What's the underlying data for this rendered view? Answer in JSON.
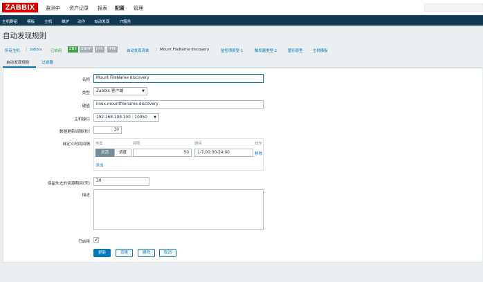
{
  "header": {
    "logo": "ZABBIX",
    "menu": [
      "监测中",
      "资产记录",
      "报表",
      "配置",
      "管理"
    ]
  },
  "subnav": [
    "主机群组",
    "模板",
    "主机",
    "维护",
    "动作",
    "自动发现",
    "IT服务"
  ],
  "page": {
    "title": "自动发现规则"
  },
  "breadcrumb": {
    "all_hosts": "所有主机",
    "sep": "/",
    "host": "zabbix",
    "enabled": "已启用",
    "badges": [
      {
        "label": "ZBX",
        "color": "#429e47"
      },
      {
        "label": "SNMP",
        "color": "#a1acb3"
      },
      {
        "label": "JMX",
        "color": "#a1acb3"
      },
      {
        "label": "IPMI",
        "color": "#a1acb3"
      }
    ],
    "discovery_list": "自动发现清单",
    "current": "Mount FileName discovery",
    "item_prototypes": "监控项原型 1",
    "trigger_prototypes": "触发器类型 2",
    "graph_prototypes": "图形原型",
    "host_prototypes": "主机模板"
  },
  "tabs": [
    "自动发现规则",
    "过滤器"
  ],
  "form": {
    "name_label": "名称",
    "name_value": "Mount FileName discovery",
    "type_label": "类型",
    "type_value": "Zabbix 客户端",
    "key_label": "键值",
    "key_value": "linux.mountfilename.discovery",
    "interface_label": "主机接口",
    "interface_value": "192.168.198.100 : 10050",
    "interval_label": "数据更新间隔(秒)",
    "interval_value": "30",
    "custom_label": "自定义时间间隔",
    "custom_headers": {
      "type": "类型",
      "interval": "间隔",
      "period": "期间",
      "action": "动作"
    },
    "custom_type_options": [
      "灵活",
      "调度"
    ],
    "custom_interval": "50",
    "custom_period": "1-7,00:00-24:00",
    "remove_link": "移除",
    "add_link": "添加",
    "keep_lost_label": "保留失去的资源期间(天)",
    "keep_lost_value": "30",
    "desc_label": "描述",
    "desc_value": "",
    "enabled_label": "已启用",
    "enabled_checked": "✔",
    "buttons": {
      "update": "更新",
      "clone": "克隆",
      "delete": "删除",
      "cancel": "取消"
    }
  }
}
